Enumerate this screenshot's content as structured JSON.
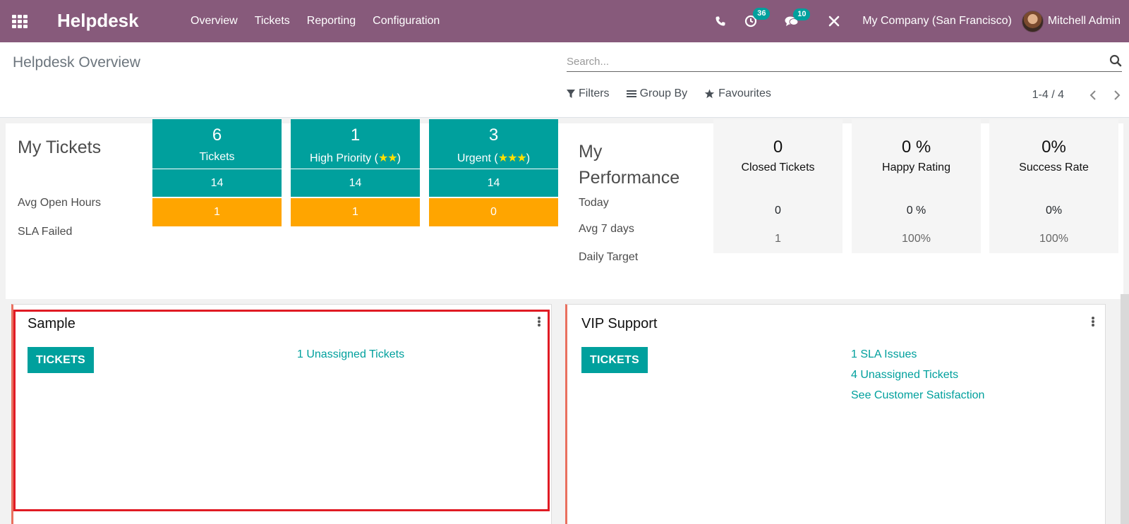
{
  "navbar": {
    "app_name": "Helpdesk",
    "menu": [
      "Overview",
      "Tickets",
      "Reporting",
      "Configuration"
    ],
    "activity_count": "36",
    "message_count": "10",
    "company": "My Company (San Francisco)",
    "user": "Mitchell Admin",
    "color": "#875a7b"
  },
  "control_panel": {
    "breadcrumb": "Helpdesk Overview",
    "search_placeholder": "Search...",
    "filters_label": "Filters",
    "group_by_label": "Group By",
    "favourites_label": "Favourites",
    "pager": "1-4 / 4"
  },
  "dashboard": {
    "my_tickets_title": "My Tickets",
    "avg_open_hours_label": "Avg Open Hours",
    "sla_failed_label": "SLA Failed",
    "tiles": [
      {
        "count": "6",
        "label": "Tickets",
        "stars": "",
        "avg_open_hours": "14",
        "sla_failed": "1"
      },
      {
        "count": "1",
        "label": "High Priority (",
        "stars": "★★",
        "suffix": ")",
        "avg_open_hours": "14",
        "sla_failed": "1"
      },
      {
        "count": "3",
        "label": "Urgent (",
        "stars": "★★★",
        "suffix": ")",
        "avg_open_hours": "14",
        "sla_failed": "0"
      }
    ],
    "performance_title_1": "My",
    "performance_title_2": "Performance",
    "today_label": "Today",
    "avg_7_days_label": "Avg 7 days",
    "daily_target_label": "Daily Target",
    "performance": [
      {
        "today": "0",
        "label": "Closed Tickets",
        "avg_7_days": "0",
        "daily_target": "1"
      },
      {
        "today": "0 %",
        "label": "Happy Rating",
        "avg_7_days": "0 %",
        "daily_target": "100%"
      },
      {
        "today": "0%",
        "label": "Success Rate",
        "avg_7_days": "0%",
        "daily_target": "100%"
      }
    ],
    "accent_color": "#00a09d",
    "warning_color": "#ffa500"
  },
  "cards": [
    {
      "title": "Sample",
      "button": "TICKETS",
      "links": [
        "1 Unassigned Tickets"
      ]
    },
    {
      "title": "VIP Support",
      "button": "TICKETS",
      "links": [
        "1 SLA Issues",
        "4 Unassigned Tickets",
        "See Customer Satisfaction"
      ]
    }
  ]
}
